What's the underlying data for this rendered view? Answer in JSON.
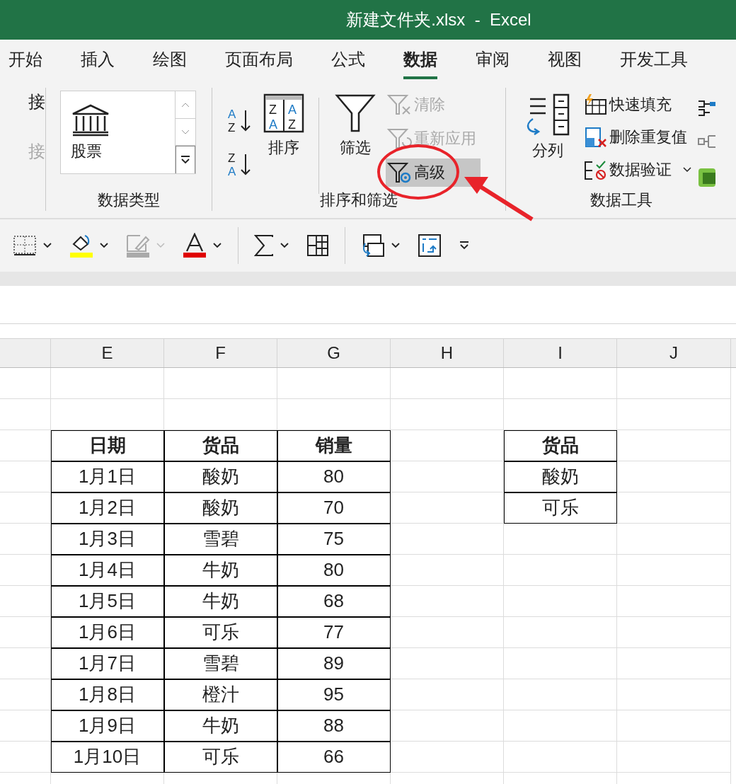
{
  "window": {
    "title": "新建文件夹.xlsx  -  Excel"
  },
  "tabs": [
    {
      "label": "开始",
      "selected": false
    },
    {
      "label": "插入",
      "selected": false
    },
    {
      "label": "绘图",
      "selected": false
    },
    {
      "label": "页面布局",
      "selected": false
    },
    {
      "label": "公式",
      "selected": false
    },
    {
      "label": "数据",
      "selected": true
    },
    {
      "label": "审阅",
      "selected": false
    },
    {
      "label": "视图",
      "selected": false
    },
    {
      "label": "开发工具",
      "selected": false
    }
  ],
  "ribbon": {
    "connections": {
      "items": [
        {
          "label": "接",
          "disabled": false
        },
        {
          "label": "接",
          "disabled": true
        }
      ]
    },
    "data_types": {
      "gallery_item": "股票",
      "label": "数据类型"
    },
    "sort_filter": {
      "ascending_icon": [
        "A",
        "Z"
      ],
      "descending_icon": [
        "Z",
        "A"
      ],
      "sort_icon": [
        [
          "Z",
          "A"
        ],
        [
          "A",
          "Z"
        ]
      ],
      "sort": "排序",
      "filter": "筛选",
      "label": "排序和筛选",
      "commands": [
        {
          "label": "清除",
          "kind": "clear",
          "disabled": true,
          "selected": false
        },
        {
          "label": "重新应用",
          "kind": "reapply",
          "disabled": true,
          "selected": false
        },
        {
          "label": "高级",
          "kind": "advanced",
          "disabled": false,
          "selected": true
        }
      ]
    },
    "data_tools": {
      "text_to_columns": "分列",
      "label": "数据工具",
      "commands": [
        {
          "label": "快速填充",
          "kind": "flash_fill"
        },
        {
          "label": "删除重复值",
          "kind": "remove_duplicates"
        },
        {
          "label": "数据验证",
          "kind": "validation"
        }
      ]
    }
  },
  "sheet": {
    "columns": [
      "E",
      "F",
      "G",
      "H",
      "I",
      "J"
    ],
    "main_table": {
      "columns": [
        "日期",
        "货品",
        "销量"
      ],
      "rows": [
        [
          "1月1日",
          "酸奶",
          "80"
        ],
        [
          "1月2日",
          "酸奶",
          "70"
        ],
        [
          "1月3日",
          "雪碧",
          "75"
        ],
        [
          "1月4日",
          "牛奶",
          "80"
        ],
        [
          "1月5日",
          "牛奶",
          "68"
        ],
        [
          "1月6日",
          "可乐",
          "77"
        ],
        [
          "1月7日",
          "雪碧",
          "89"
        ],
        [
          "1月8日",
          "橙汁",
          "95"
        ],
        [
          "1月9日",
          "牛奶",
          "88"
        ],
        [
          "1月10日",
          "可乐",
          "66"
        ]
      ]
    },
    "criteria_table": {
      "column": "货品",
      "rows": [
        "酸奶",
        "可乐"
      ]
    }
  }
}
